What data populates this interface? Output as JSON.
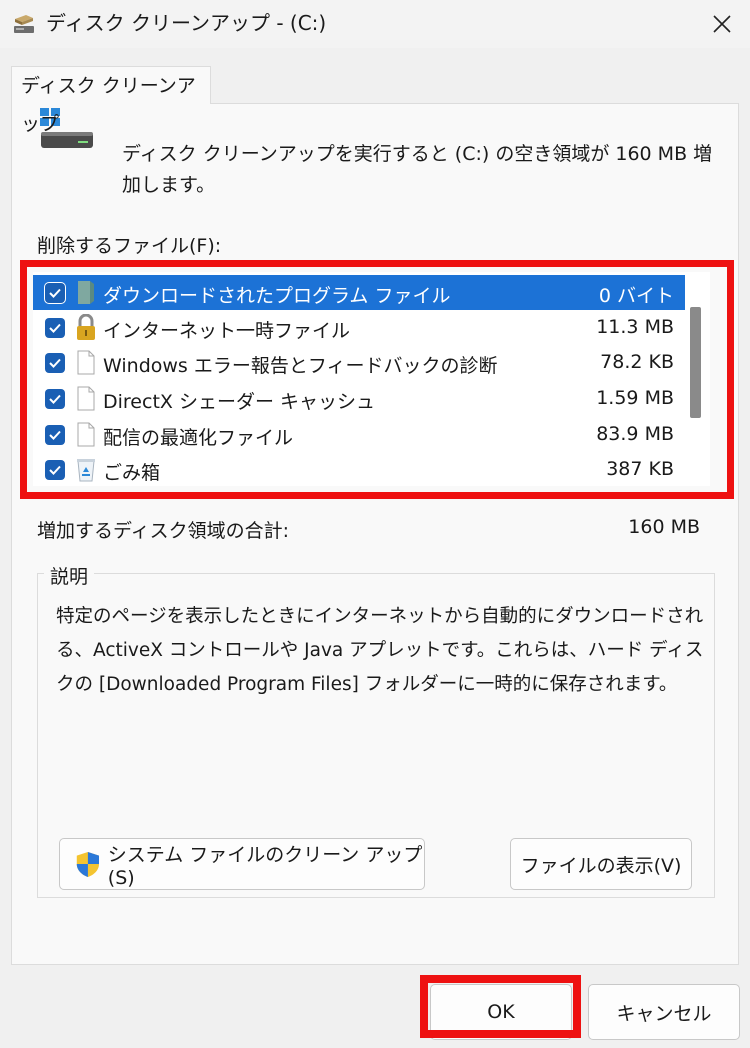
{
  "window": {
    "title": "ディスク クリーンアップ - (C:)"
  },
  "tab": {
    "label": "ディスク クリーンアップ"
  },
  "intro": {
    "text": "ディスク クリーンアップを実行すると (C:) の空き領域が 160 MB 増加します。"
  },
  "files": {
    "label": "削除するファイル(F):",
    "items": [
      {
        "name": "ダウンロードされたプログラム ファイル",
        "size": "0 バイト",
        "checked": true,
        "selected": true,
        "icon": "folder-icon"
      },
      {
        "name": "インターネット一時ファイル",
        "size": "11.3 MB",
        "checked": true,
        "icon": "lock-icon"
      },
      {
        "name": "Windows エラー報告とフィードバックの診断",
        "size": "78.2 KB",
        "checked": true,
        "icon": "document-icon"
      },
      {
        "name": "DirectX シェーダー キャッシュ",
        "size": "1.59 MB",
        "checked": true,
        "icon": "document-icon"
      },
      {
        "name": "配信の最適化ファイル",
        "size": "83.9 MB",
        "checked": true,
        "icon": "document-icon"
      },
      {
        "name": "ごみ箱",
        "size": "387 KB",
        "checked": true,
        "icon": "recycle-bin-icon"
      }
    ]
  },
  "total": {
    "label": "増加するディスク領域の合計:",
    "value": "160 MB"
  },
  "description": {
    "legend": "説明",
    "text": "特定のページを表示したときにインターネットから自動的にダウンロードされる、ActiveX コントロールや Java アプレットです。これらは、ハード ディスクの [Downloaded Program Files] フォルダーに一時的に保存されます。"
  },
  "buttons": {
    "system_cleanup": "システム ファイルのクリーン アップ(S)",
    "view_files": "ファイルの表示(V)",
    "ok": "OK",
    "cancel": "キャンセル"
  },
  "colors": {
    "selection": "#1c72d6",
    "checkbox": "#1a5fb4",
    "highlight": "#ee1111"
  }
}
